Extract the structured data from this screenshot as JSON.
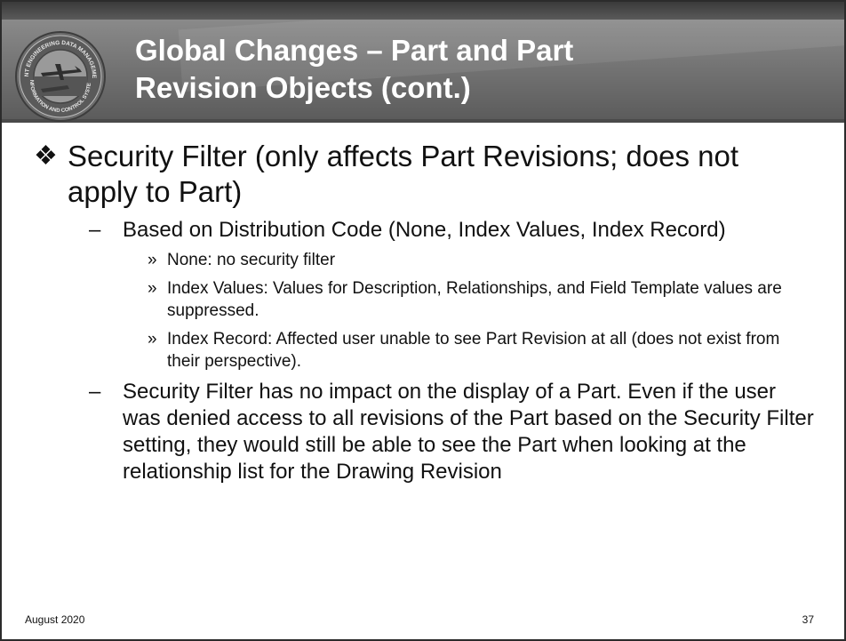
{
  "title": {
    "line1": "Global Changes – Part and Part",
    "line2": "Revision Objects (cont.)"
  },
  "logo": {
    "icon": "seal-emblem",
    "text_top": "JOINT ENGINEERING DATA MANAGEMENT",
    "text_bottom": "INFORMATION AND CONTROL SYSTEM"
  },
  "content": {
    "main_bullet": "Security Filter (only affects Part Revisions; does not apply to Part)",
    "sub1": "Based on Distribution Code (None, Index Values, Index Record)",
    "sub1_items": [
      "None: no security filter",
      "Index Values: Values for Description, Relationships, and Field Template values are suppressed.",
      "Index Record: Affected user unable to see Part Revision at all (does not exist from their perspective)."
    ],
    "sub2": "Security Filter has no impact on the display of a Part. Even if the user was denied access to all revisions of the Part based on the Security Filter setting, they would still be able to see the Part when looking at the relationship list for the Drawing Revision"
  },
  "footer": {
    "date": "August 2020",
    "page_number": "37"
  },
  "colors": {
    "title_band": "#787878",
    "top_band": "#404040",
    "title_text": "#ffffff",
    "body_text": "#111111"
  }
}
